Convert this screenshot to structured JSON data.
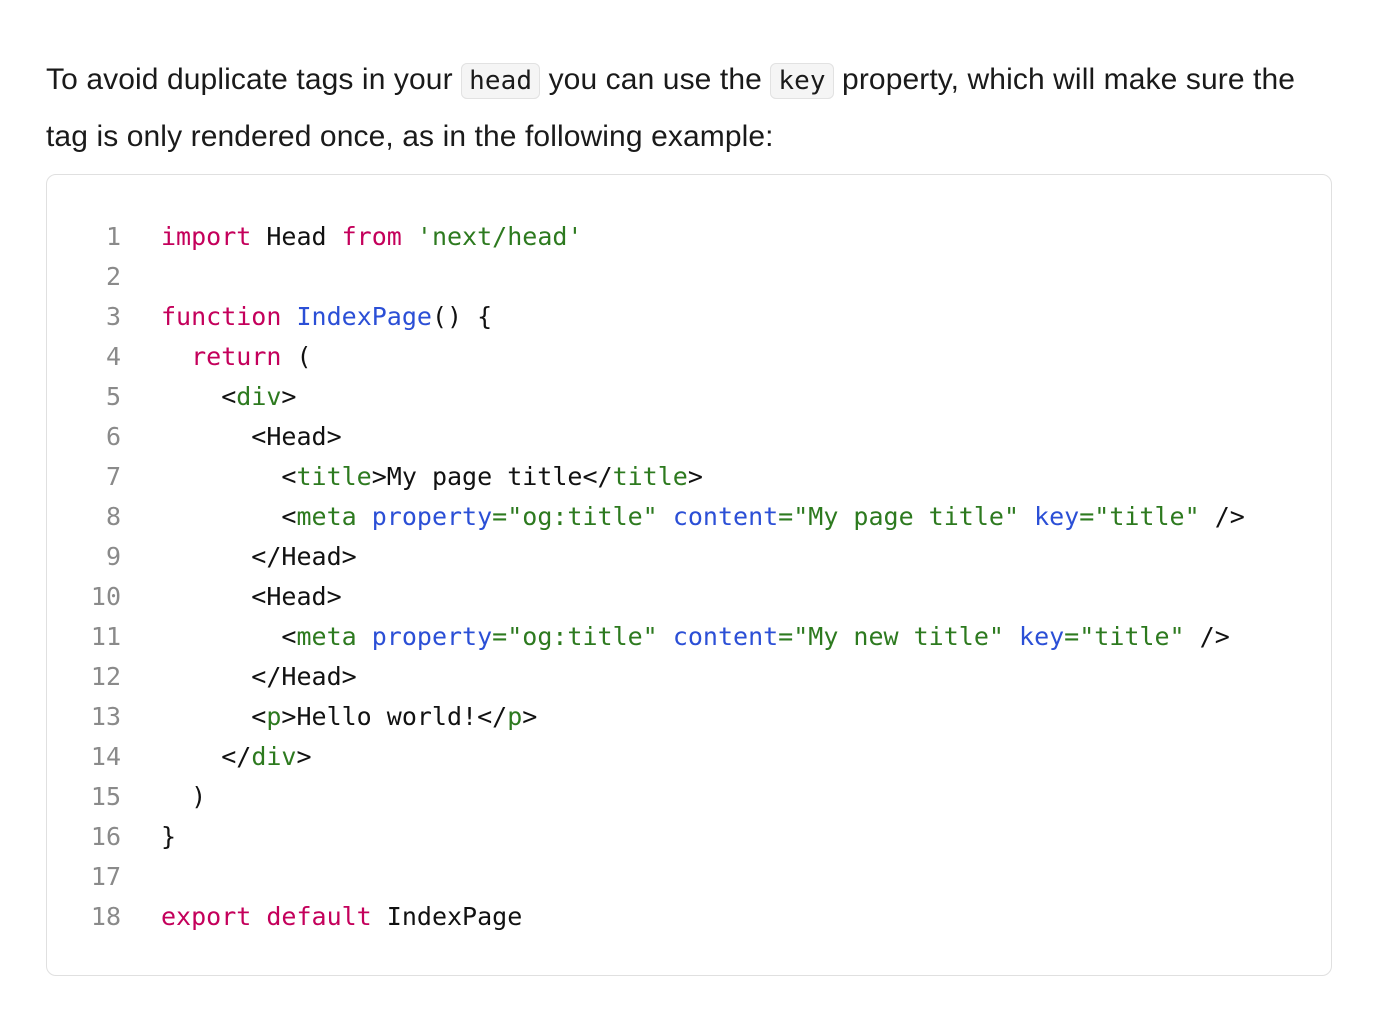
{
  "intro": {
    "before_head": "To avoid duplicate tags in your ",
    "code_head": "head",
    "between": " you can use the ",
    "code_key": "key",
    "after_key": " property, which will make sure the tag is only rendered once, as in the following example:"
  },
  "code": {
    "language": "jsx",
    "lines": [
      {
        "num": "1",
        "tokens": [
          [
            "kw",
            "import"
          ],
          [
            "pl",
            " Head "
          ],
          [
            "kw",
            "from"
          ],
          [
            "pl",
            " "
          ],
          [
            "str",
            "'next/head'"
          ]
        ]
      },
      {
        "num": "2",
        "tokens": []
      },
      {
        "num": "3",
        "tokens": [
          [
            "kw",
            "function"
          ],
          [
            "pl",
            " "
          ],
          [
            "fn",
            "IndexPage"
          ],
          [
            "pl",
            "() {"
          ]
        ]
      },
      {
        "num": "4",
        "tokens": [
          [
            "pl",
            "  "
          ],
          [
            "kw",
            "return"
          ],
          [
            "pl",
            " ("
          ]
        ]
      },
      {
        "num": "5",
        "tokens": [
          [
            "pl",
            "    <"
          ],
          [
            "tag",
            "div"
          ],
          [
            "pl",
            ">"
          ]
        ]
      },
      {
        "num": "6",
        "tokens": [
          [
            "pl",
            "      <Head>"
          ]
        ]
      },
      {
        "num": "7",
        "tokens": [
          [
            "pl",
            "        <"
          ],
          [
            "tag",
            "title"
          ],
          [
            "pl",
            ">My page title</"
          ],
          [
            "tag",
            "title"
          ],
          [
            "pl",
            ">"
          ]
        ]
      },
      {
        "num": "8",
        "tokens": [
          [
            "pl",
            "        <"
          ],
          [
            "tag",
            "meta"
          ],
          [
            "pl",
            " "
          ],
          [
            "attr",
            "property"
          ],
          [
            "str",
            "=\"og:title\""
          ],
          [
            "pl",
            " "
          ],
          [
            "attr",
            "content"
          ],
          [
            "str",
            "=\"My page title\""
          ],
          [
            "pl",
            " "
          ],
          [
            "attr",
            "key"
          ],
          [
            "str",
            "=\"title\""
          ],
          [
            "pl",
            " />"
          ]
        ]
      },
      {
        "num": "9",
        "tokens": [
          [
            "pl",
            "      </Head>"
          ]
        ]
      },
      {
        "num": "10",
        "tokens": [
          [
            "pl",
            "      <Head>"
          ]
        ]
      },
      {
        "num": "11",
        "tokens": [
          [
            "pl",
            "        <"
          ],
          [
            "tag",
            "meta"
          ],
          [
            "pl",
            " "
          ],
          [
            "attr",
            "property"
          ],
          [
            "str",
            "=\"og:title\""
          ],
          [
            "pl",
            " "
          ],
          [
            "attr",
            "content"
          ],
          [
            "str",
            "=\"My new title\""
          ],
          [
            "pl",
            " "
          ],
          [
            "attr",
            "key"
          ],
          [
            "str",
            "=\"title\""
          ],
          [
            "pl",
            " />"
          ]
        ]
      },
      {
        "num": "12",
        "tokens": [
          [
            "pl",
            "      </Head>"
          ]
        ]
      },
      {
        "num": "13",
        "tokens": [
          [
            "pl",
            "      <"
          ],
          [
            "tag",
            "p"
          ],
          [
            "pl",
            ">Hello world!</"
          ],
          [
            "tag",
            "p"
          ],
          [
            "pl",
            ">"
          ]
        ]
      },
      {
        "num": "14",
        "tokens": [
          [
            "pl",
            "    </"
          ],
          [
            "tag",
            "div"
          ],
          [
            "pl",
            ">"
          ]
        ]
      },
      {
        "num": "15",
        "tokens": [
          [
            "pl",
            "  )"
          ]
        ]
      },
      {
        "num": "16",
        "tokens": [
          [
            "pl",
            "}"
          ]
        ]
      },
      {
        "num": "17",
        "tokens": []
      },
      {
        "num": "18",
        "tokens": [
          [
            "kw",
            "export"
          ],
          [
            "pl",
            " "
          ],
          [
            "kw",
            "default"
          ],
          [
            "pl",
            " IndexPage"
          ]
        ]
      }
    ]
  },
  "colors": {
    "keyword": "#c4005b",
    "function": "#2b4fd6",
    "tag": "#2d7a1f",
    "string": "#2d7a1f",
    "attribute": "#2b4fd6",
    "line_number": "#8a8a8a"
  }
}
